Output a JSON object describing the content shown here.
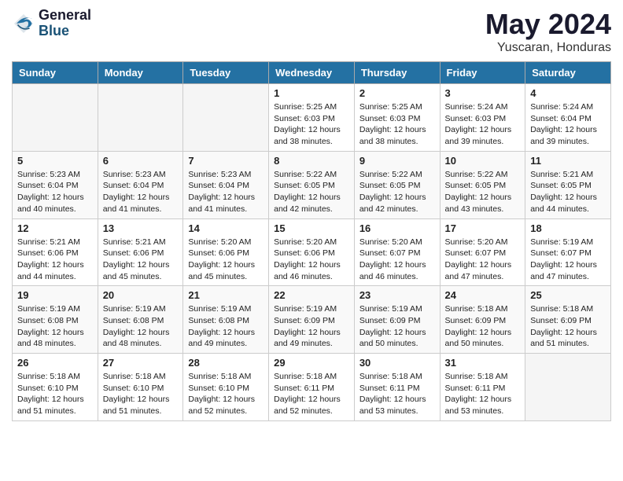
{
  "logo": {
    "general": "General",
    "blue": "Blue"
  },
  "title": "May 2024",
  "location": "Yuscaran, Honduras",
  "days_header": [
    "Sunday",
    "Monday",
    "Tuesday",
    "Wednesday",
    "Thursday",
    "Friday",
    "Saturday"
  ],
  "weeks": [
    {
      "cells": [
        {
          "day": "",
          "info": ""
        },
        {
          "day": "",
          "info": ""
        },
        {
          "day": "",
          "info": ""
        },
        {
          "day": "1",
          "info": "Sunrise: 5:25 AM\nSunset: 6:03 PM\nDaylight: 12 hours\nand 38 minutes."
        },
        {
          "day": "2",
          "info": "Sunrise: 5:25 AM\nSunset: 6:03 PM\nDaylight: 12 hours\nand 38 minutes."
        },
        {
          "day": "3",
          "info": "Sunrise: 5:24 AM\nSunset: 6:03 PM\nDaylight: 12 hours\nand 39 minutes."
        },
        {
          "day": "4",
          "info": "Sunrise: 5:24 AM\nSunset: 6:04 PM\nDaylight: 12 hours\nand 39 minutes."
        }
      ]
    },
    {
      "cells": [
        {
          "day": "5",
          "info": "Sunrise: 5:23 AM\nSunset: 6:04 PM\nDaylight: 12 hours\nand 40 minutes."
        },
        {
          "day": "6",
          "info": "Sunrise: 5:23 AM\nSunset: 6:04 PM\nDaylight: 12 hours\nand 41 minutes."
        },
        {
          "day": "7",
          "info": "Sunrise: 5:23 AM\nSunset: 6:04 PM\nDaylight: 12 hours\nand 41 minutes."
        },
        {
          "day": "8",
          "info": "Sunrise: 5:22 AM\nSunset: 6:05 PM\nDaylight: 12 hours\nand 42 minutes."
        },
        {
          "day": "9",
          "info": "Sunrise: 5:22 AM\nSunset: 6:05 PM\nDaylight: 12 hours\nand 42 minutes."
        },
        {
          "day": "10",
          "info": "Sunrise: 5:22 AM\nSunset: 6:05 PM\nDaylight: 12 hours\nand 43 minutes."
        },
        {
          "day": "11",
          "info": "Sunrise: 5:21 AM\nSunset: 6:05 PM\nDaylight: 12 hours\nand 44 minutes."
        }
      ]
    },
    {
      "cells": [
        {
          "day": "12",
          "info": "Sunrise: 5:21 AM\nSunset: 6:06 PM\nDaylight: 12 hours\nand 44 minutes."
        },
        {
          "day": "13",
          "info": "Sunrise: 5:21 AM\nSunset: 6:06 PM\nDaylight: 12 hours\nand 45 minutes."
        },
        {
          "day": "14",
          "info": "Sunrise: 5:20 AM\nSunset: 6:06 PM\nDaylight: 12 hours\nand 45 minutes."
        },
        {
          "day": "15",
          "info": "Sunrise: 5:20 AM\nSunset: 6:06 PM\nDaylight: 12 hours\nand 46 minutes."
        },
        {
          "day": "16",
          "info": "Sunrise: 5:20 AM\nSunset: 6:07 PM\nDaylight: 12 hours\nand 46 minutes."
        },
        {
          "day": "17",
          "info": "Sunrise: 5:20 AM\nSunset: 6:07 PM\nDaylight: 12 hours\nand 47 minutes."
        },
        {
          "day": "18",
          "info": "Sunrise: 5:19 AM\nSunset: 6:07 PM\nDaylight: 12 hours\nand 47 minutes."
        }
      ]
    },
    {
      "cells": [
        {
          "day": "19",
          "info": "Sunrise: 5:19 AM\nSunset: 6:08 PM\nDaylight: 12 hours\nand 48 minutes."
        },
        {
          "day": "20",
          "info": "Sunrise: 5:19 AM\nSunset: 6:08 PM\nDaylight: 12 hours\nand 48 minutes."
        },
        {
          "day": "21",
          "info": "Sunrise: 5:19 AM\nSunset: 6:08 PM\nDaylight: 12 hours\nand 49 minutes."
        },
        {
          "day": "22",
          "info": "Sunrise: 5:19 AM\nSunset: 6:09 PM\nDaylight: 12 hours\nand 49 minutes."
        },
        {
          "day": "23",
          "info": "Sunrise: 5:19 AM\nSunset: 6:09 PM\nDaylight: 12 hours\nand 50 minutes."
        },
        {
          "day": "24",
          "info": "Sunrise: 5:18 AM\nSunset: 6:09 PM\nDaylight: 12 hours\nand 50 minutes."
        },
        {
          "day": "25",
          "info": "Sunrise: 5:18 AM\nSunset: 6:09 PM\nDaylight: 12 hours\nand 51 minutes."
        }
      ]
    },
    {
      "cells": [
        {
          "day": "26",
          "info": "Sunrise: 5:18 AM\nSunset: 6:10 PM\nDaylight: 12 hours\nand 51 minutes."
        },
        {
          "day": "27",
          "info": "Sunrise: 5:18 AM\nSunset: 6:10 PM\nDaylight: 12 hours\nand 51 minutes."
        },
        {
          "day": "28",
          "info": "Sunrise: 5:18 AM\nSunset: 6:10 PM\nDaylight: 12 hours\nand 52 minutes."
        },
        {
          "day": "29",
          "info": "Sunrise: 5:18 AM\nSunset: 6:11 PM\nDaylight: 12 hours\nand 52 minutes."
        },
        {
          "day": "30",
          "info": "Sunrise: 5:18 AM\nSunset: 6:11 PM\nDaylight: 12 hours\nand 53 minutes."
        },
        {
          "day": "31",
          "info": "Sunrise: 5:18 AM\nSunset: 6:11 PM\nDaylight: 12 hours\nand 53 minutes."
        },
        {
          "day": "",
          "info": ""
        }
      ]
    }
  ]
}
